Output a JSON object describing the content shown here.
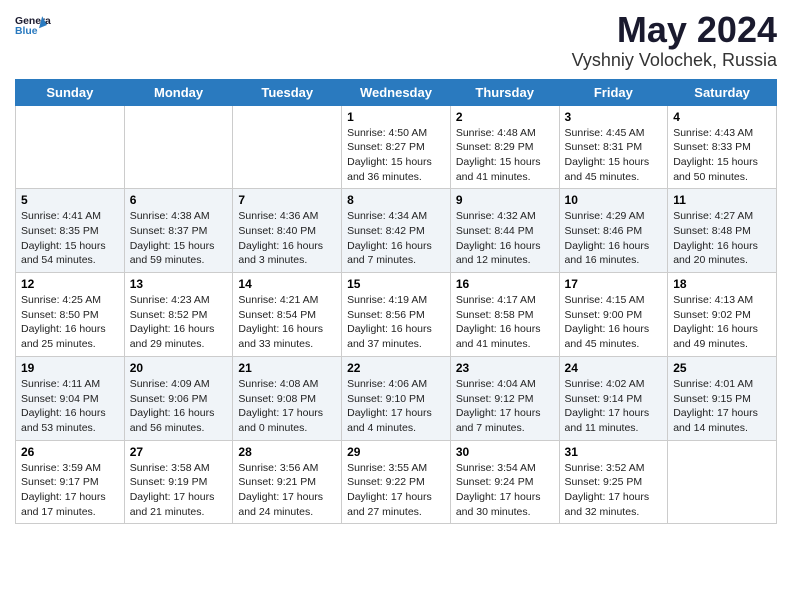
{
  "header": {
    "logo_general": "General",
    "logo_blue": "Blue",
    "title": "May 2024",
    "subtitle": "Vyshniy Volochek, Russia"
  },
  "days_of_week": [
    "Sunday",
    "Monday",
    "Tuesday",
    "Wednesday",
    "Thursday",
    "Friday",
    "Saturday"
  ],
  "weeks": [
    [
      {
        "day": "",
        "info": ""
      },
      {
        "day": "",
        "info": ""
      },
      {
        "day": "",
        "info": ""
      },
      {
        "day": "1",
        "info": "Sunrise: 4:50 AM\nSunset: 8:27 PM\nDaylight: 15 hours\nand 36 minutes."
      },
      {
        "day": "2",
        "info": "Sunrise: 4:48 AM\nSunset: 8:29 PM\nDaylight: 15 hours\nand 41 minutes."
      },
      {
        "day": "3",
        "info": "Sunrise: 4:45 AM\nSunset: 8:31 PM\nDaylight: 15 hours\nand 45 minutes."
      },
      {
        "day": "4",
        "info": "Sunrise: 4:43 AM\nSunset: 8:33 PM\nDaylight: 15 hours\nand 50 minutes."
      }
    ],
    [
      {
        "day": "5",
        "info": "Sunrise: 4:41 AM\nSunset: 8:35 PM\nDaylight: 15 hours\nand 54 minutes."
      },
      {
        "day": "6",
        "info": "Sunrise: 4:38 AM\nSunset: 8:37 PM\nDaylight: 15 hours\nand 59 minutes."
      },
      {
        "day": "7",
        "info": "Sunrise: 4:36 AM\nSunset: 8:40 PM\nDaylight: 16 hours\nand 3 minutes."
      },
      {
        "day": "8",
        "info": "Sunrise: 4:34 AM\nSunset: 8:42 PM\nDaylight: 16 hours\nand 7 minutes."
      },
      {
        "day": "9",
        "info": "Sunrise: 4:32 AM\nSunset: 8:44 PM\nDaylight: 16 hours\nand 12 minutes."
      },
      {
        "day": "10",
        "info": "Sunrise: 4:29 AM\nSunset: 8:46 PM\nDaylight: 16 hours\nand 16 minutes."
      },
      {
        "day": "11",
        "info": "Sunrise: 4:27 AM\nSunset: 8:48 PM\nDaylight: 16 hours\nand 20 minutes."
      }
    ],
    [
      {
        "day": "12",
        "info": "Sunrise: 4:25 AM\nSunset: 8:50 PM\nDaylight: 16 hours\nand 25 minutes."
      },
      {
        "day": "13",
        "info": "Sunrise: 4:23 AM\nSunset: 8:52 PM\nDaylight: 16 hours\nand 29 minutes."
      },
      {
        "day": "14",
        "info": "Sunrise: 4:21 AM\nSunset: 8:54 PM\nDaylight: 16 hours\nand 33 minutes."
      },
      {
        "day": "15",
        "info": "Sunrise: 4:19 AM\nSunset: 8:56 PM\nDaylight: 16 hours\nand 37 minutes."
      },
      {
        "day": "16",
        "info": "Sunrise: 4:17 AM\nSunset: 8:58 PM\nDaylight: 16 hours\nand 41 minutes."
      },
      {
        "day": "17",
        "info": "Sunrise: 4:15 AM\nSunset: 9:00 PM\nDaylight: 16 hours\nand 45 minutes."
      },
      {
        "day": "18",
        "info": "Sunrise: 4:13 AM\nSunset: 9:02 PM\nDaylight: 16 hours\nand 49 minutes."
      }
    ],
    [
      {
        "day": "19",
        "info": "Sunrise: 4:11 AM\nSunset: 9:04 PM\nDaylight: 16 hours\nand 53 minutes."
      },
      {
        "day": "20",
        "info": "Sunrise: 4:09 AM\nSunset: 9:06 PM\nDaylight: 16 hours\nand 56 minutes."
      },
      {
        "day": "21",
        "info": "Sunrise: 4:08 AM\nSunset: 9:08 PM\nDaylight: 17 hours\nand 0 minutes."
      },
      {
        "day": "22",
        "info": "Sunrise: 4:06 AM\nSunset: 9:10 PM\nDaylight: 17 hours\nand 4 minutes."
      },
      {
        "day": "23",
        "info": "Sunrise: 4:04 AM\nSunset: 9:12 PM\nDaylight: 17 hours\nand 7 minutes."
      },
      {
        "day": "24",
        "info": "Sunrise: 4:02 AM\nSunset: 9:14 PM\nDaylight: 17 hours\nand 11 minutes."
      },
      {
        "day": "25",
        "info": "Sunrise: 4:01 AM\nSunset: 9:15 PM\nDaylight: 17 hours\nand 14 minutes."
      }
    ],
    [
      {
        "day": "26",
        "info": "Sunrise: 3:59 AM\nSunset: 9:17 PM\nDaylight: 17 hours\nand 17 minutes."
      },
      {
        "day": "27",
        "info": "Sunrise: 3:58 AM\nSunset: 9:19 PM\nDaylight: 17 hours\nand 21 minutes."
      },
      {
        "day": "28",
        "info": "Sunrise: 3:56 AM\nSunset: 9:21 PM\nDaylight: 17 hours\nand 24 minutes."
      },
      {
        "day": "29",
        "info": "Sunrise: 3:55 AM\nSunset: 9:22 PM\nDaylight: 17 hours\nand 27 minutes."
      },
      {
        "day": "30",
        "info": "Sunrise: 3:54 AM\nSunset: 9:24 PM\nDaylight: 17 hours\nand 30 minutes."
      },
      {
        "day": "31",
        "info": "Sunrise: 3:52 AM\nSunset: 9:25 PM\nDaylight: 17 hours\nand 32 minutes."
      },
      {
        "day": "",
        "info": ""
      }
    ]
  ]
}
